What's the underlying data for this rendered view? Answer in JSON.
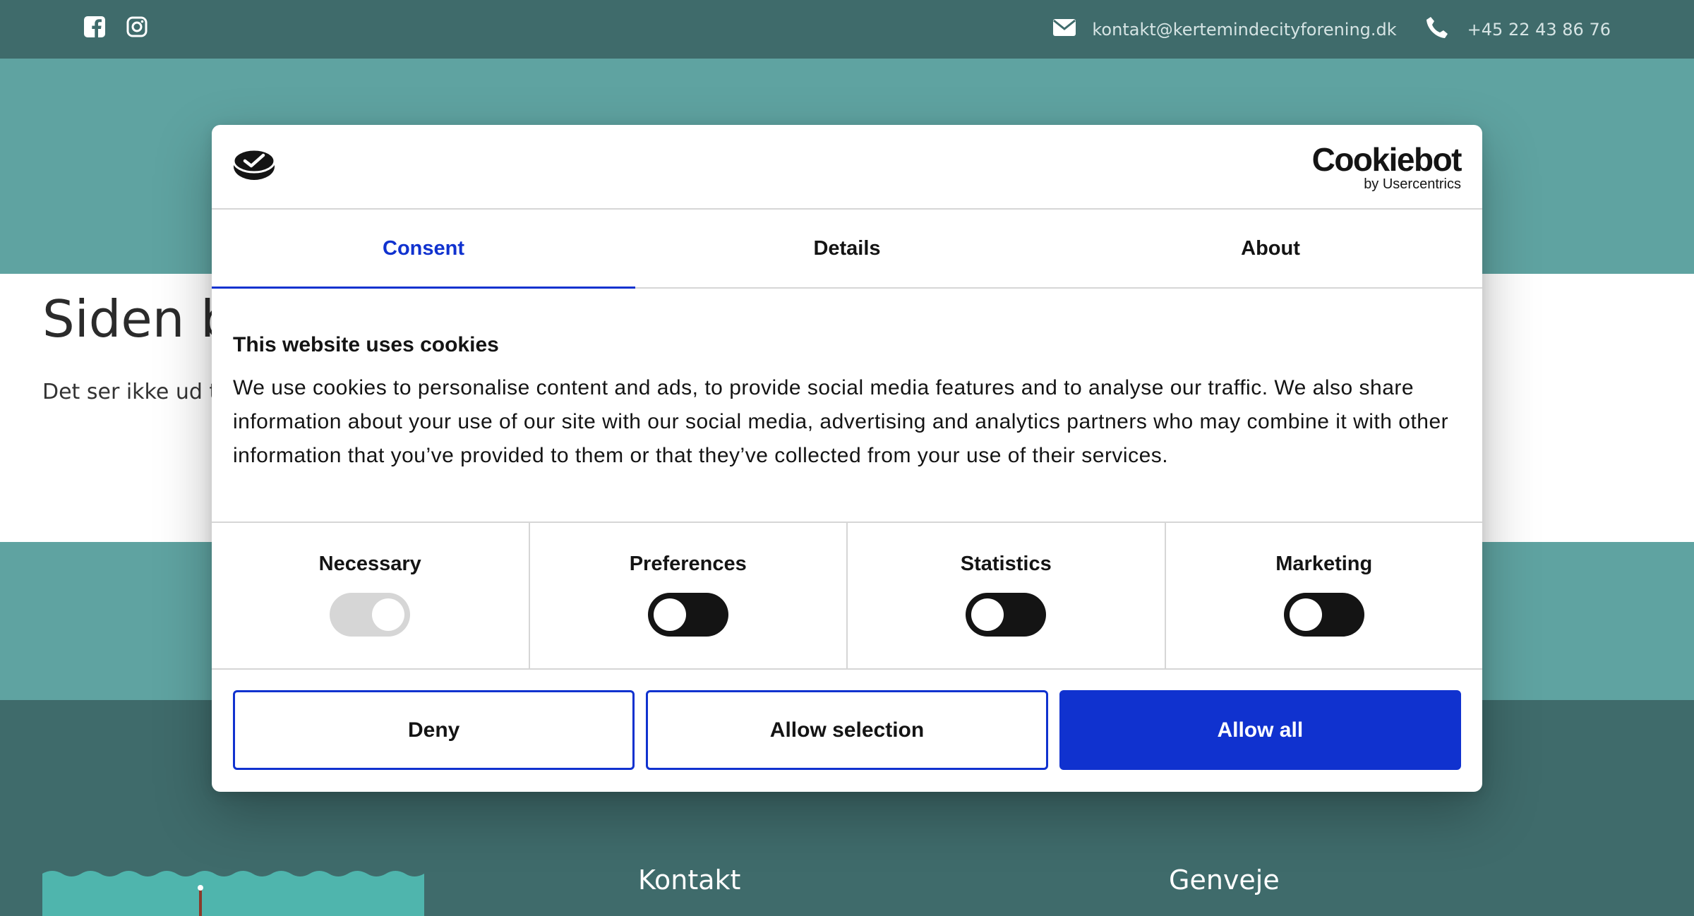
{
  "topbar": {
    "email": "kontakt@kertemindecityforening.dk",
    "phone": "+45 22 43 86 76",
    "social_icons": [
      "facebook-icon",
      "instagram-icon"
    ]
  },
  "page": {
    "heading_partial": "Siden b",
    "text_partial": "Det ser ikke ud ti"
  },
  "footer": {
    "col1": "Kontakt",
    "col2": "Genveje"
  },
  "dialog": {
    "brand": "Cookiebot",
    "brand_sub": "by Usercentrics",
    "tabs": [
      {
        "label": "Consent",
        "active": true
      },
      {
        "label": "Details",
        "active": false
      },
      {
        "label": "About",
        "active": false
      }
    ],
    "title": "This website uses cookies",
    "body": "We use cookies to personalise content and ads, to provide social media features and to analyse our traffic. We also share information about your use of our site with our social media, advertising and analytics partners who may combine it with other information that you’ve provided to them or that they’ve collected from your use of their services.",
    "toggles": [
      {
        "label": "Necessary",
        "state": "on",
        "disabled": true
      },
      {
        "label": "Preferences",
        "state": "off",
        "disabled": false
      },
      {
        "label": "Statistics",
        "state": "off",
        "disabled": false
      },
      {
        "label": "Marketing",
        "state": "off",
        "disabled": false
      }
    ],
    "buttons": {
      "deny": "Deny",
      "allow_selection": "Allow selection",
      "allow_all": "Allow all"
    }
  },
  "colors": {
    "accent": "#1032cf",
    "teal_light": "#5fa3a1",
    "teal_dark": "#3f6b6b"
  }
}
